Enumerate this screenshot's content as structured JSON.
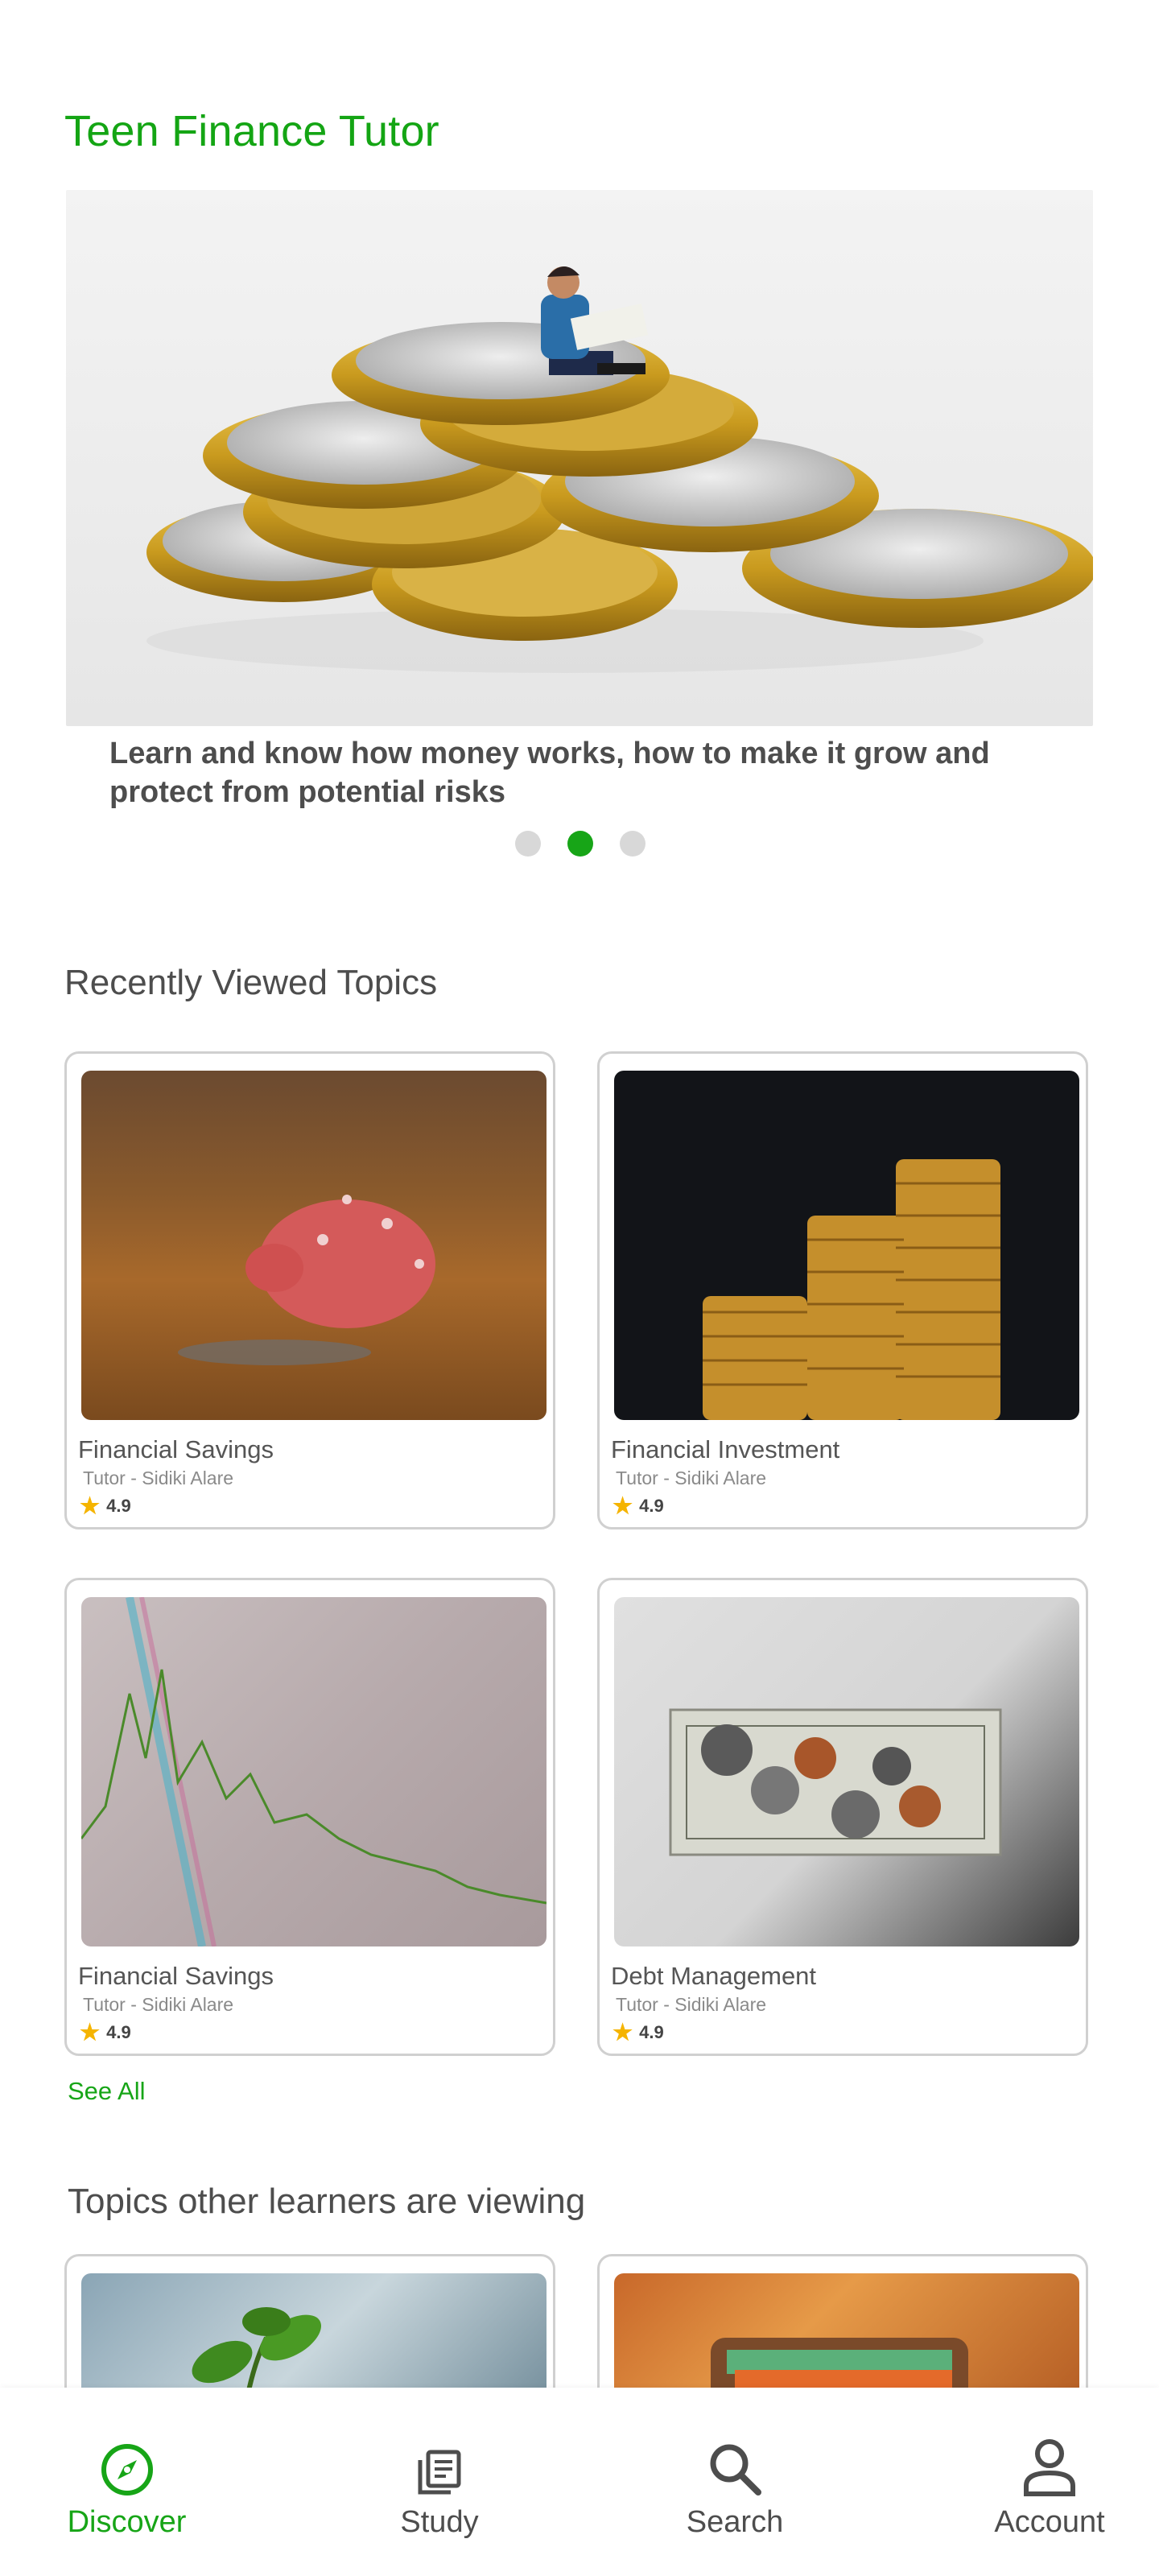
{
  "app": {
    "title": "Teen Finance Tutor"
  },
  "hero": {
    "caption": "Learn and know how money works, how to make it grow and protect from potential risks",
    "slides": 3,
    "active_slide": 2
  },
  "recent": {
    "title": "Recently Viewed Topics",
    "cards": [
      {
        "title": "Financial Savings",
        "tutor": "Tutor - Sidiki Alare",
        "rating": "4.9",
        "image": "piggy-bank"
      },
      {
        "title": "Financial Investment",
        "tutor": "Tutor - Sidiki Alare",
        "rating": "4.9",
        "image": "coin-stacks"
      },
      {
        "title": "Financial Savings",
        "tutor": "Tutor - Sidiki Alare",
        "rating": "4.9",
        "image": "stock-chart"
      },
      {
        "title": "Debt Management",
        "tutor": "Tutor - Sidiki Alare",
        "rating": "4.9",
        "image": "dollar-coins"
      }
    ],
    "see_all": "See All"
  },
  "others": {
    "title": "Topics  other learners are viewing",
    "cards": [
      {
        "image": "plant"
      },
      {
        "image": "wallet"
      }
    ]
  },
  "nav": {
    "items": [
      {
        "label": "Discover",
        "icon": "compass-icon",
        "active": true
      },
      {
        "label": "Study",
        "icon": "book-icon",
        "active": false
      },
      {
        "label": "Search",
        "icon": "search-icon",
        "active": false
      },
      {
        "label": "Account",
        "icon": "person-icon",
        "active": false
      }
    ]
  },
  "colors": {
    "brand": "#17a517",
    "text": "#4d4d4d",
    "star": "#f5b400"
  }
}
